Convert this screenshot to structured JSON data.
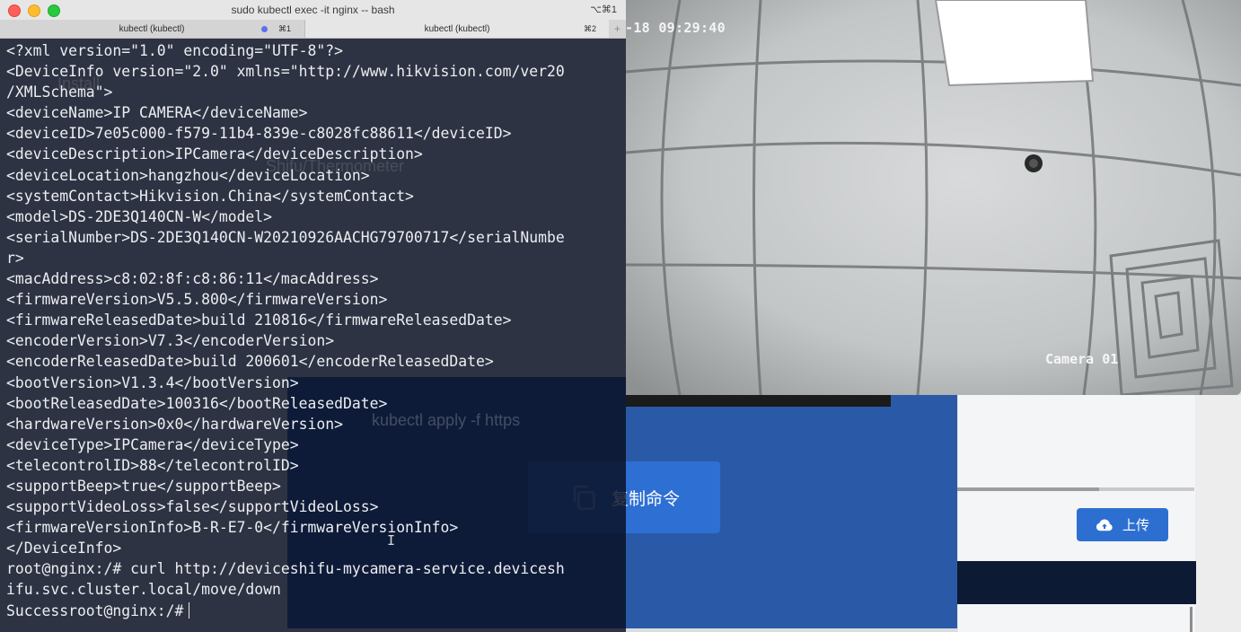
{
  "window": {
    "title": "sudo kubectl exec -it nginx -- bash",
    "shortcut": "⌥⌘1"
  },
  "tabs": [
    {
      "label": "kubectl (kubectl)",
      "shortcut": "⌘1",
      "has_activity": true
    },
    {
      "label": "kubectl (kubectl)",
      "shortcut": "⌘2",
      "active": true
    }
  ],
  "new_tab_label": "+",
  "terminal": {
    "lines": [
      "<?xml version=\"1.0\" encoding=\"UTF-8\"?>",
      "<DeviceInfo version=\"2.0\" xmlns=\"http://www.hikvision.com/ver20",
      "/XMLSchema\">",
      "<deviceName>IP CAMERA</deviceName>",
      "<deviceID>7e05c000-f579-11b4-839e-c8028fc88611</deviceID>",
      "<deviceDescription>IPCamera</deviceDescription>",
      "<deviceLocation>hangzhou</deviceLocation>",
      "<systemContact>Hikvision.China</systemContact>",
      "<model>DS-2DE3Q140CN-W</model>",
      "<serialNumber>DS-2DE3Q140CN-W20210926AACHG79700717</serialNumbe",
      "r>",
      "<macAddress>c8:02:8f:c8:86:11</macAddress>",
      "<firmwareVersion>V5.5.800</firmwareVersion>",
      "<firmwareReleasedDate>build 210816</firmwareReleasedDate>",
      "<encoderVersion>V7.3</encoderVersion>",
      "<encoderReleasedDate>build 200601</encoderReleasedDate>",
      "<bootVersion>V1.3.4</bootVersion>",
      "<bootReleasedDate>100316</bootReleasedDate>",
      "<hardwareVersion>0x0</hardwareVersion>",
      "<deviceType>IPCamera</deviceType>",
      "<telecontrolID>88</telecontrolID>",
      "<supportBeep>true</supportBeep>",
      "<supportVideoLoss>false</supportVideoLoss>",
      "<firmwareVersionInfo>B-R-E7-0</firmwareVersionInfo>",
      "</DeviceInfo>",
      "root@nginx:/# curl http://deviceshifu-mycamera-service.devicesh",
      "ifu.svc.cluster.local/move/down"
    ],
    "prompt_line": "Successroot@nginx:/#"
  },
  "camera": {
    "timestamp": "-18 09:29:40",
    "label": "Camera 01"
  },
  "background_page": {
    "copy_button": "复制命令",
    "upload_button": "上传",
    "ghost_apply": "kubectl apply -f https",
    "ghost_thermometer": "Shifu/Thermometer",
    "ghost_install": "Install"
  },
  "colors": {
    "terminal_bg": "#080e20",
    "primary_blue": "#2e6fd3",
    "panel_blue": "#2a5aa7",
    "navy": "#0d1a33"
  },
  "upload_progress": 0.6
}
